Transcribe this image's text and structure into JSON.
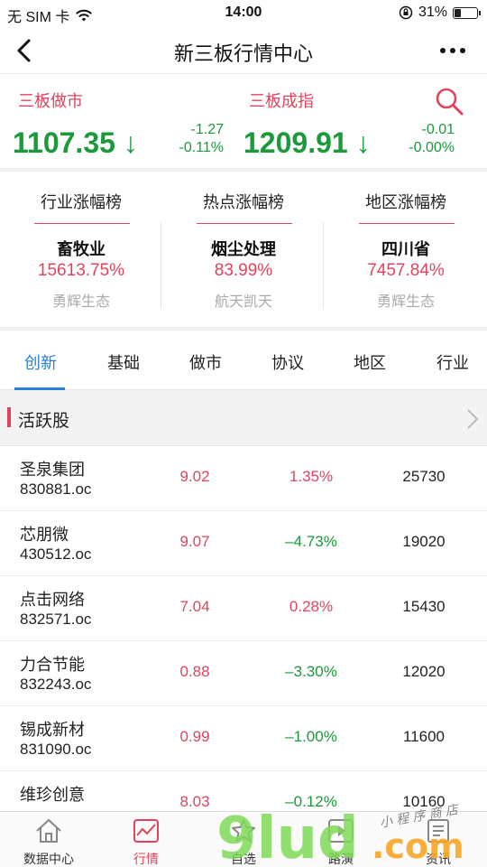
{
  "status_bar": {
    "carrier": "无 SIM 卡",
    "time": "14:00",
    "battery_pct": "31%",
    "battery_level": 0.31
  },
  "navbar": {
    "title": "新三板行情中心"
  },
  "indices": [
    {
      "name": "三板做市",
      "value": "1107.35 ↓",
      "change": "-1.27",
      "change_pct": "-0.11%"
    },
    {
      "name": "三板成指",
      "value": "1209.91 ↓",
      "change": "-0.01",
      "change_pct": "-0.00%"
    }
  ],
  "ranks": [
    {
      "title": "行业涨幅榜",
      "name": "畜牧业",
      "pct": "15613.75%",
      "sub": "勇辉生态"
    },
    {
      "title": "热点涨幅榜",
      "name": "烟尘处理",
      "pct": "83.99%",
      "sub": "航天凯天"
    },
    {
      "title": "地区涨幅榜",
      "name": "四川省",
      "pct": "7457.84%",
      "sub": "勇辉生态"
    }
  ],
  "tabs": [
    "创新",
    "基础",
    "做市",
    "协议",
    "地区",
    "行业"
  ],
  "section": {
    "title": "活跃股"
  },
  "stocks": [
    {
      "name": "圣泉集团",
      "code": "830881.oc",
      "price": "9.02",
      "pct": "1.35%",
      "dir": "up",
      "volume": "25730"
    },
    {
      "name": "芯朋微",
      "code": "430512.oc",
      "price": "9.07",
      "pct": "–4.73%",
      "dir": "down",
      "volume": "19020"
    },
    {
      "name": "点击网络",
      "code": "832571.oc",
      "price": "7.04",
      "pct": "0.28%",
      "dir": "up",
      "volume": "15430"
    },
    {
      "name": "力合节能",
      "code": "832243.oc",
      "price": "0.88",
      "pct": "–3.30%",
      "dir": "down",
      "volume": "12020"
    },
    {
      "name": "锡成新材",
      "code": "831090.oc",
      "price": "0.99",
      "pct": "–1.00%",
      "dir": "down",
      "volume": "11600"
    },
    {
      "name": "维珍创意",
      "code": "",
      "price": "8.03",
      "pct": "–0.12%",
      "dir": "down",
      "volume": "10160"
    }
  ],
  "tabbar": [
    {
      "label": "数据中心",
      "icon": "home-icon"
    },
    {
      "label": "行情",
      "icon": "chart-icon"
    },
    {
      "label": "自选",
      "icon": "star-icon"
    },
    {
      "label": "路演",
      "icon": "play-icon"
    },
    {
      "label": "资讯",
      "icon": "news-icon"
    }
  ],
  "active_tab": "创新",
  "active_bottom_tab": "行情",
  "colors": {
    "up": "#e0445c",
    "down": "#1a9a3a",
    "accent": "#2a7fd4"
  },
  "watermark": {
    "text": "9lud.com",
    "tagline": "小程序商店"
  }
}
